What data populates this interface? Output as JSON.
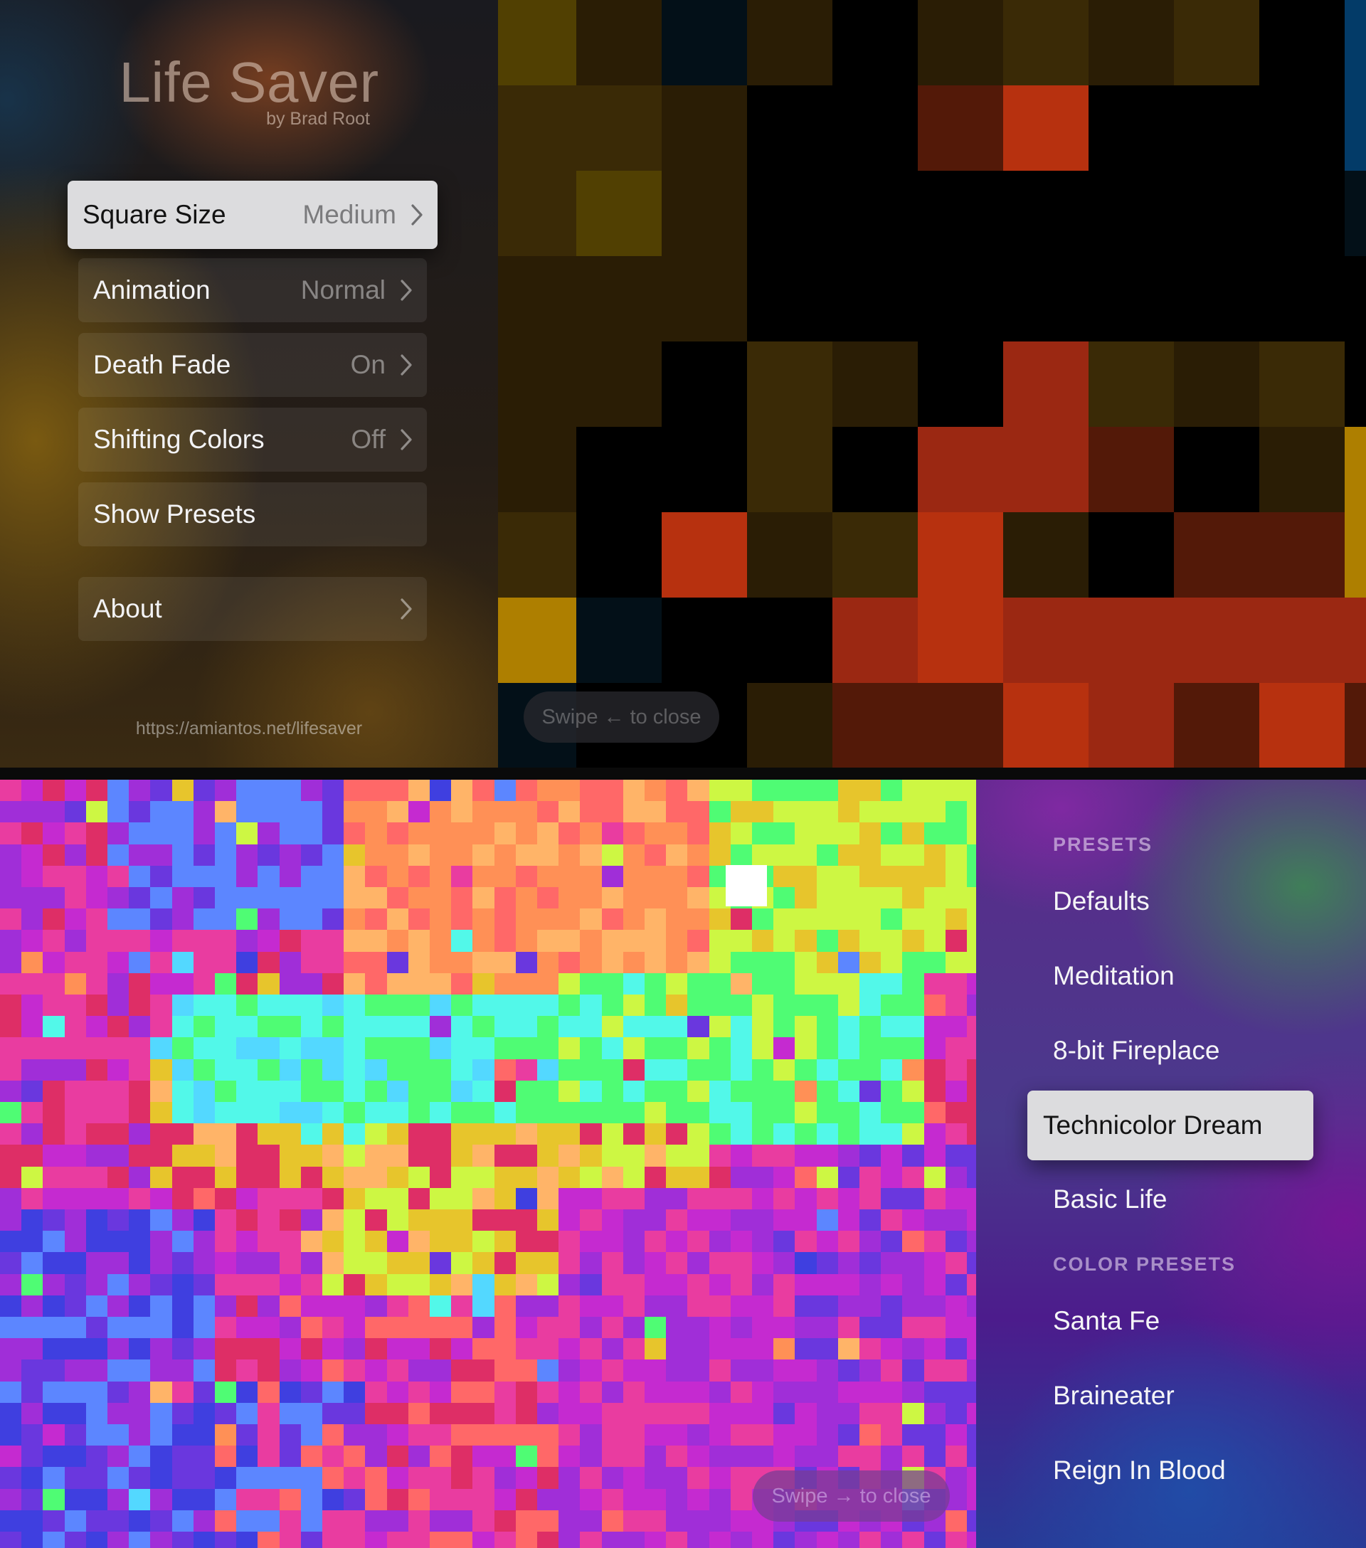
{
  "settings": {
    "app_title": "Life Saver",
    "author": "by Brad Root",
    "url": "https://amiantos.net/lifesaver",
    "menu": [
      {
        "label": "Square Size",
        "value": "Medium",
        "chevron": true,
        "focused": true
      },
      {
        "label": "Animation",
        "value": "Normal",
        "chevron": true
      },
      {
        "label": "Death Fade",
        "value": "On",
        "chevron": true
      },
      {
        "label": "Shifting Colors",
        "value": "Off",
        "chevron": true
      },
      {
        "label": "Show Presets",
        "value": "",
        "chevron": false
      },
      {
        "label": "About",
        "value": "",
        "chevron": true
      }
    ],
    "swipe_hint": "Swipe ← to close"
  },
  "presets": {
    "section_presets": "PRESETS",
    "items": [
      "Defaults",
      "Meditation",
      "8-bit Fireplace",
      "Technicolor Dream",
      "Basic Life"
    ],
    "focused_index": 3,
    "section_color_presets": "COLOR PRESETS",
    "color_items": [
      "Santa Fe",
      "Braineater",
      "Reign In Blood"
    ],
    "swipe_hint": "Swipe → to close"
  },
  "icons": {
    "chevron": "chevron-right-icon"
  },
  "colors": {
    "top_palette": [
      "#000000",
      "#2a1d05",
      "#3a2a06",
      "#514002",
      "#ae7f00",
      "#031018",
      "#033b68",
      "#26120e",
      "#380f0a",
      "#531908",
      "#7c230f",
      "#9b2812",
      "#b7310f"
    ],
    "bottom_palette": [
      "#e93ca0",
      "#c52ad0",
      "#a02ed8",
      "#6a37de",
      "#3f3fe0",
      "#5c86ff",
      "#53d8ff",
      "#52f8e9",
      "#4ffc74",
      "#cdf743",
      "#e7c52c",
      "#ff9056",
      "#ff6868",
      "#ffb468",
      "#de2e66"
    ],
    "focus_background": "#dcdcde"
  }
}
